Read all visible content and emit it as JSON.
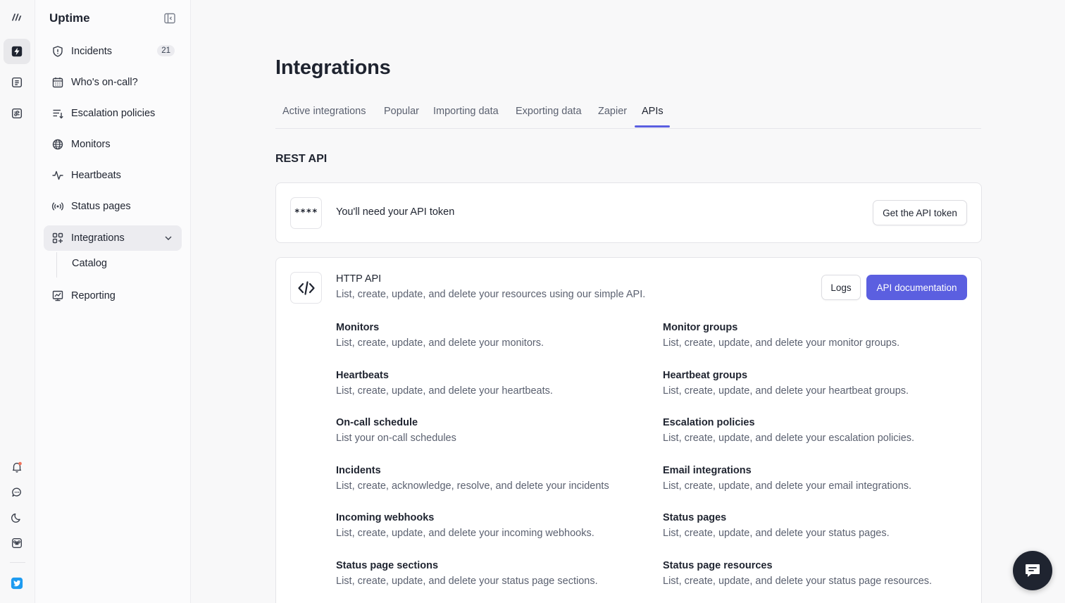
{
  "app": {
    "title": "Uptime"
  },
  "rail": {
    "items": [
      {
        "icon": "logo-icon"
      },
      {
        "icon": "lightning-icon",
        "active": true
      },
      {
        "icon": "list-icon"
      },
      {
        "icon": "sliders-icon"
      },
      {
        "icon": "bell-icon"
      },
      {
        "icon": "chat-icon"
      },
      {
        "icon": "moon-icon"
      },
      {
        "icon": "command-icon"
      },
      {
        "icon": "twitter-icon"
      }
    ]
  },
  "sidebar": {
    "items": [
      {
        "label": "Incidents",
        "badge": "21",
        "icon": "shield-icon"
      },
      {
        "label": "Who's on-call?",
        "icon": "calendar-icon"
      },
      {
        "label": "Escalation policies",
        "icon": "escalation-icon"
      },
      {
        "label": "Monitors",
        "icon": "globe-icon"
      },
      {
        "label": "Heartbeats",
        "icon": "pulse-icon"
      },
      {
        "label": "Status pages",
        "icon": "broadcast-icon"
      },
      {
        "label": "Integrations",
        "icon": "apps-icon",
        "active": true,
        "expanded": true
      },
      {
        "label": "Reporting",
        "icon": "chart-icon"
      }
    ],
    "subitems": [
      {
        "label": "Catalog"
      }
    ]
  },
  "main": {
    "title": "Integrations",
    "tabs": [
      {
        "label": "Active integrations"
      },
      {
        "label": "Popular"
      },
      {
        "label": "Importing data"
      },
      {
        "label": "Exporting data"
      },
      {
        "label": "Zapier"
      },
      {
        "label": "APIs",
        "active": true
      }
    ],
    "section_title": "REST API",
    "token_card": {
      "icon_text": "****",
      "text": "You'll need your API token",
      "button": "Get the API token"
    },
    "http_card": {
      "title": "HTTP API",
      "description": "List, create, update, and delete your resources using our simple API.",
      "logs_button": "Logs",
      "docs_button": "API documentation",
      "resources": [
        {
          "name": "Monitors",
          "description": "List, create, update, and delete your monitors."
        },
        {
          "name": "Monitor groups",
          "description": "List, create, update, and delete your monitor groups."
        },
        {
          "name": "Heartbeats",
          "description": "List, create, update, and delete your heartbeats."
        },
        {
          "name": "Heartbeat groups",
          "description": "List, create, update, and delete your heartbeat groups."
        },
        {
          "name": "On-call schedule",
          "description": "List your on-call schedules"
        },
        {
          "name": "Escalation policies",
          "description": "List, create, update, and delete your escalation policies."
        },
        {
          "name": "Incidents",
          "description": "List, create, acknowledge, resolve, and delete your incidents"
        },
        {
          "name": "Email integrations",
          "description": "List, create, update, and delete your email integrations."
        },
        {
          "name": "Incoming webhooks",
          "description": "List, create, update, and delete your incoming webhooks."
        },
        {
          "name": "Status pages",
          "description": "List, create, update, and delete your status pages."
        },
        {
          "name": "Status page sections",
          "description": "List, create, update, and delete your status page sections."
        },
        {
          "name": "Status page resources",
          "description": "List, create, update, and delete your status page resources."
        }
      ]
    }
  },
  "colors": {
    "accent": "#5b5fe0",
    "text": "#1f2430",
    "muted": "#5b6170",
    "notification": "#f0735a"
  }
}
